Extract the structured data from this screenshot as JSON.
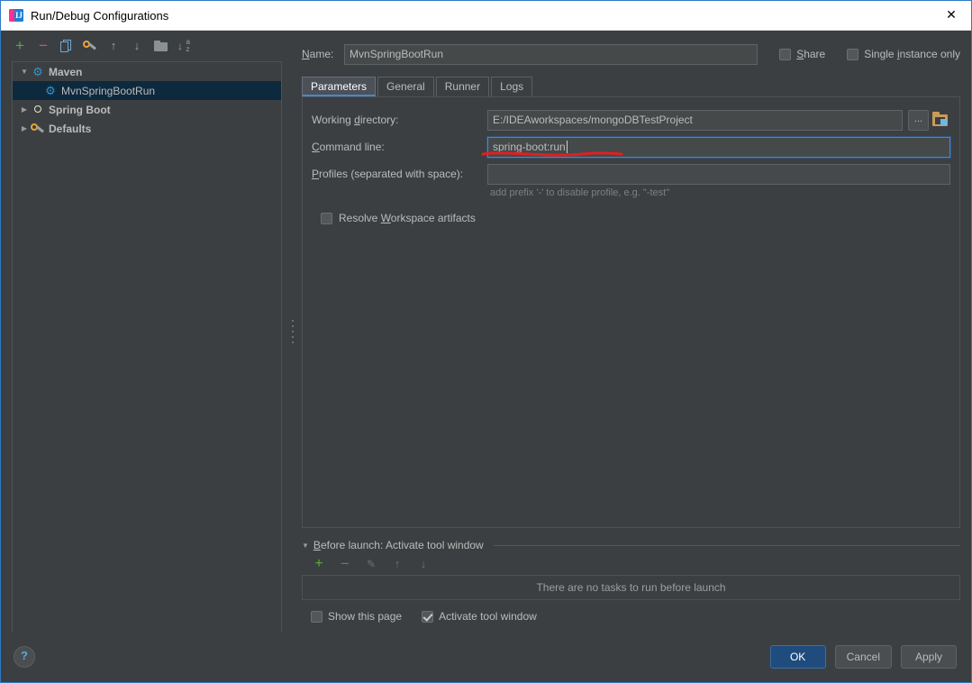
{
  "window": {
    "title": "Run/Debug Configurations",
    "app_icon": "intellij-idea-icon",
    "close_label": "✕"
  },
  "sidebar": {
    "toolbar": [
      {
        "name": "add-configuration-button",
        "icon": "plus-icon",
        "label": "+"
      },
      {
        "name": "remove-configuration-button",
        "icon": "minus-icon",
        "label": "−"
      },
      {
        "name": "copy-configuration-button",
        "icon": "copy-icon",
        "label": ""
      },
      {
        "name": "edit-defaults-button",
        "icon": "wrench-icon",
        "label": ""
      },
      {
        "name": "move-up-button",
        "icon": "arrow-up-icon",
        "label": "↑"
      },
      {
        "name": "move-down-button",
        "icon": "arrow-down-icon",
        "label": "↓"
      },
      {
        "name": "create-folder-button",
        "icon": "folder-icon",
        "label": ""
      },
      {
        "name": "sort-configurations-button",
        "icon": "sort-alpha-icon",
        "label": ""
      }
    ],
    "tree": [
      {
        "label": "Maven",
        "icon": "gear-icon",
        "arrow": "▼",
        "level": 0,
        "bold": true,
        "selected": false
      },
      {
        "label": "MvnSpringBootRun",
        "icon": "gear-icon",
        "arrow": "",
        "level": 1,
        "bold": false,
        "selected": true
      },
      {
        "label": "Spring Boot",
        "icon": "spring-leaf-icon",
        "arrow": "▶",
        "level": 0,
        "bold": true,
        "selected": false
      },
      {
        "label": "Defaults",
        "icon": "wrench-icon",
        "arrow": "▶",
        "level": 0,
        "bold": true,
        "selected": false
      }
    ]
  },
  "header": {
    "name_label": "Name:",
    "name_mnemonic": "N",
    "name_value": "MvnSpringBootRun",
    "share_label": "Share",
    "share_checked": false,
    "single_instance_label": "Single instance only",
    "single_instance_checked": false
  },
  "tabs": [
    {
      "label": "Parameters",
      "active": true
    },
    {
      "label": "General",
      "active": false
    },
    {
      "label": "Runner",
      "active": false
    },
    {
      "label": "Logs",
      "active": false
    }
  ],
  "parameters": {
    "working_directory_label": "Working directory:",
    "working_directory_value": "E:/IDEAworkspaces/mongoDBTestProject",
    "browse_button_label": "...",
    "folder_button_icon": "open-folder-icon",
    "command_line_label": "Command line:",
    "command_line_value": "spring-boot:run",
    "command_line_focused": true,
    "profiles_label": "Profiles (separated with space):",
    "profiles_value": "",
    "profiles_hint": "add prefix '-' to disable profile, e.g. \"-test\"",
    "resolve_workspace_label": "Resolve Workspace artifacts",
    "resolve_workspace_checked": false
  },
  "before_launch": {
    "arrow": "▼",
    "title": "Before launch: Activate tool window",
    "toolbar": [
      {
        "name": "add-task-button",
        "icon": "plus-icon",
        "label": "+",
        "enabled": true
      },
      {
        "name": "remove-task-button",
        "icon": "minus-icon",
        "label": "−",
        "enabled": false
      },
      {
        "name": "edit-task-button",
        "icon": "pencil-icon",
        "label": "✎",
        "enabled": false
      },
      {
        "name": "move-task-up-button",
        "icon": "arrow-up-icon",
        "label": "↑",
        "enabled": false
      },
      {
        "name": "move-task-down-button",
        "icon": "arrow-down-icon",
        "label": "↓",
        "enabled": false
      }
    ],
    "empty_text": "There are no tasks to run before launch",
    "show_page_label": "Show this page",
    "show_page_checked": false,
    "activate_tool_window_label": "Activate tool window",
    "activate_tool_window_checked": true
  },
  "footer": {
    "help_label": "?",
    "ok_label": "OK",
    "cancel_label": "Cancel",
    "apply_label": "Apply"
  },
  "colors": {
    "accent_blue": "#4a88c7",
    "selection_blue": "#0d293e",
    "primary_button": "#1f4b7d",
    "annotation_red": "#e02020",
    "background": "#3c3f41"
  }
}
